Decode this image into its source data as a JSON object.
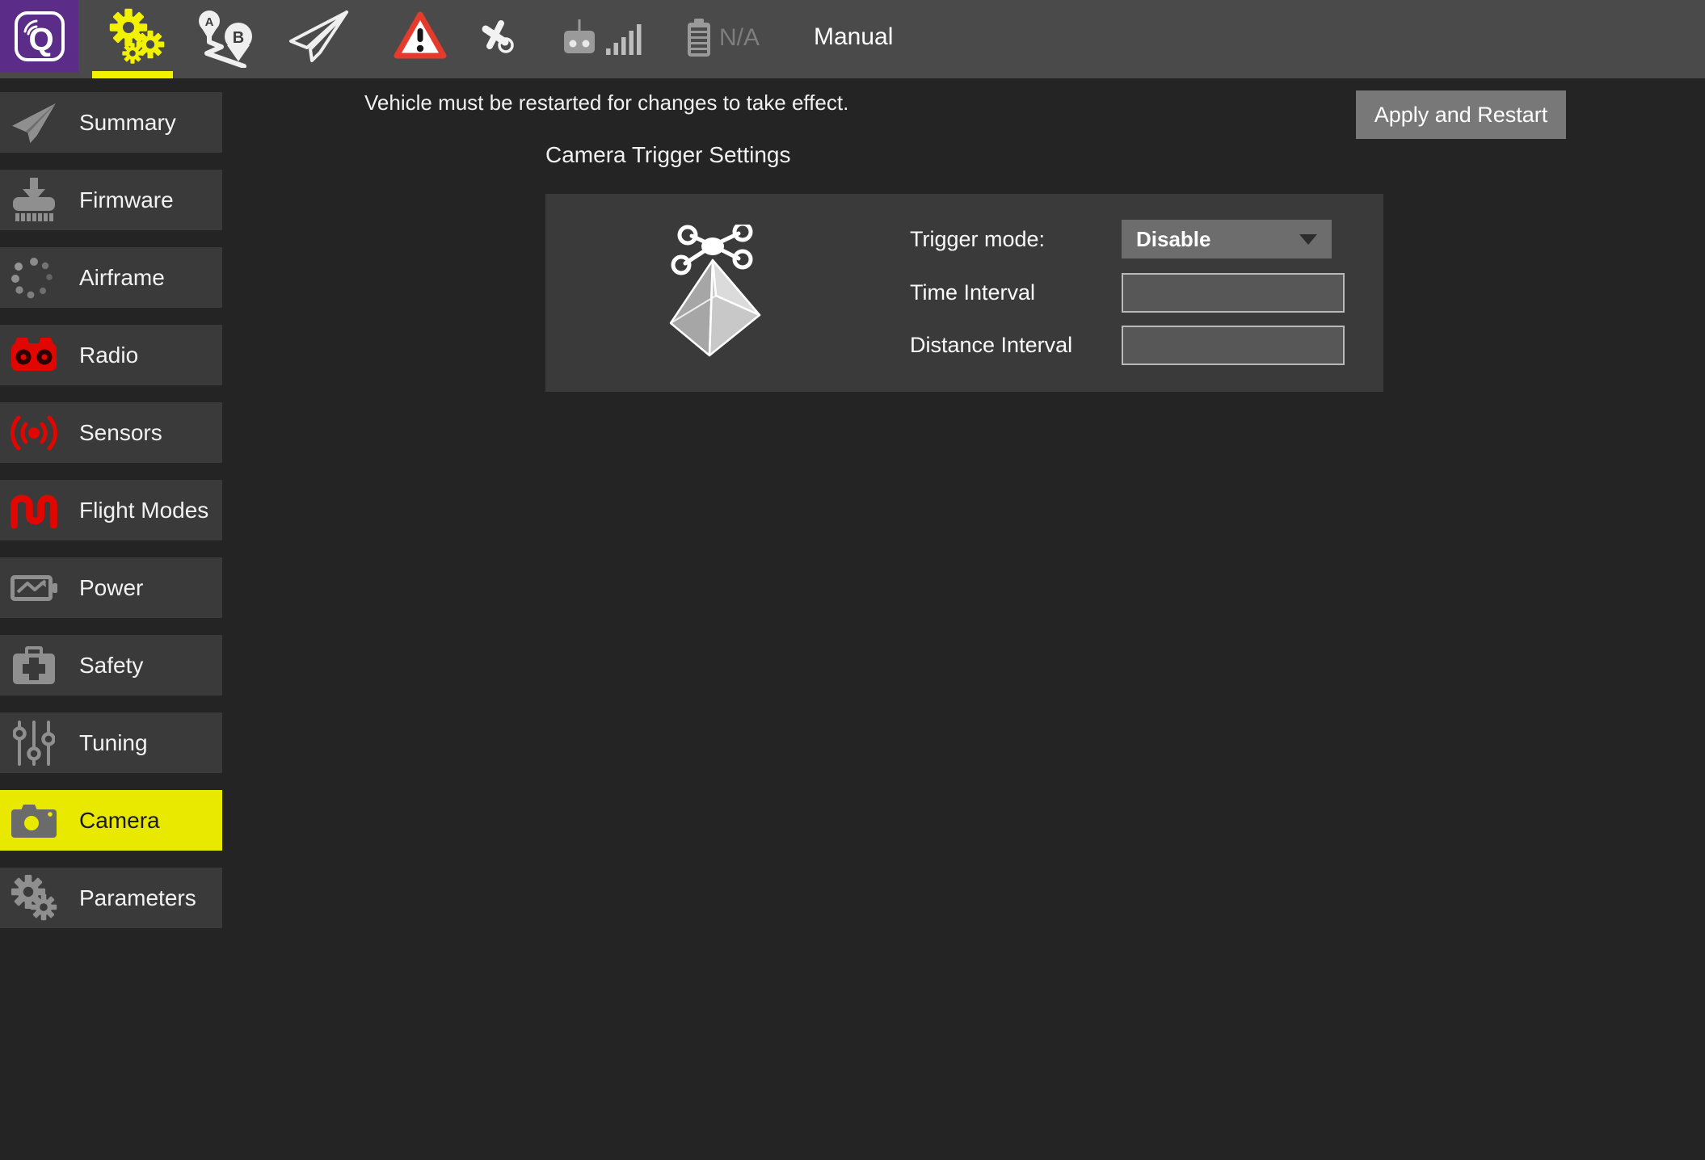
{
  "toolbar": {
    "logo_letter": "Q",
    "flight_mode_label": "Manual",
    "battery_status": "N/A",
    "tabs": [
      {
        "icon": "gears-setup-icon",
        "active": true
      },
      {
        "icon": "plan-route-icon",
        "active": false
      },
      {
        "icon": "fly-paper-plane-icon",
        "active": false
      },
      {
        "icon": "warning-triangle-icon",
        "active": false
      },
      {
        "icon": "gps-satellite-icon",
        "active": false
      },
      {
        "icon": "rc-transmitter-icon",
        "active": false
      },
      {
        "icon": "telemetry-signal-bars-icon",
        "active": false
      },
      {
        "icon": "battery-icon",
        "active": false
      }
    ]
  },
  "plan_icon": {
    "pin_a": "A",
    "pin_b": "B"
  },
  "sidebar": {
    "items": [
      {
        "label": "Summary",
        "icon": "paper-plane-icon",
        "active": false
      },
      {
        "label": "Firmware",
        "icon": "firmware-flash-icon",
        "active": false
      },
      {
        "label": "Airframe",
        "icon": "airframe-dots-icon",
        "active": false
      },
      {
        "label": "Radio",
        "icon": "radio-receiver-icon",
        "active": false
      },
      {
        "label": "Sensors",
        "icon": "sensor-waves-icon",
        "active": false
      },
      {
        "label": "Flight Modes",
        "icon": "flight-modes-wave-icon",
        "active": false
      },
      {
        "label": "Power",
        "icon": "power-battery-icon",
        "active": false
      },
      {
        "label": "Safety",
        "icon": "safety-case-icon",
        "active": false
      },
      {
        "label": "Tuning",
        "icon": "tuning-sliders-icon",
        "active": false
      },
      {
        "label": "Camera",
        "icon": "camera-icon",
        "active": true
      },
      {
        "label": "Parameters",
        "icon": "parameters-gears-icon",
        "active": false
      }
    ]
  },
  "main": {
    "restart_notice": "Vehicle must be restarted for changes to take effect.",
    "apply_button_label": "Apply and Restart",
    "section_title": "Camera Trigger Settings",
    "trigger": {
      "mode_label": "Trigger mode:",
      "mode_value": "Disable",
      "time_interval_label": "Time Interval",
      "time_interval_value": "",
      "distance_interval_label": "Distance Interval",
      "distance_interval_value": ""
    }
  },
  "colors": {
    "accent_yellow": "#F2F200",
    "active_row_yellow": "#E9E900",
    "brand_purple": "#5B2C88",
    "alert_red": "#E10600",
    "toolbar_gray": "#4A4A4A",
    "row_gray": "#3A3A3A",
    "background": "#242424"
  }
}
